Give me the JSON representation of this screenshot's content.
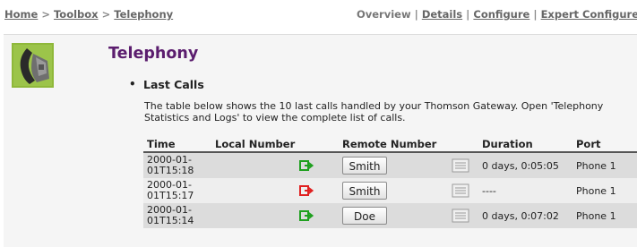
{
  "breadcrumb": {
    "home": "Home",
    "sep1": ">",
    "toolbox": "Toolbox",
    "sep2": ">",
    "telephony": "Telephony"
  },
  "views": {
    "overview": "Overview",
    "sep1": "|",
    "details": "Details",
    "sep2": "|",
    "configure": "Configure",
    "sep3": "|",
    "expert": "Expert Configure"
  },
  "page": {
    "title": "Telephony",
    "section": "Last Calls",
    "description": "The table below shows the 10 last calls handled by your Thomson Gateway. Open 'Telephony Statistics and Logs' to view the complete list of calls."
  },
  "table": {
    "headers": {
      "time": "Time",
      "local": "Local Number",
      "remote": "Remote Number",
      "duration": "Duration",
      "port": "Port"
    },
    "rows": [
      {
        "time_line1": "2000-01-",
        "time_line2": "01T15:18",
        "direction": "green-arrow-icon",
        "arrow_color": "#1fa01f",
        "contact": "Smith",
        "duration": "0 days, 0:05:05",
        "port": "Phone 1"
      },
      {
        "time_line1": "2000-01-",
        "time_line2": "01T15:17",
        "direction": "red-arrow-icon",
        "arrow_color": "#e02020",
        "contact": "Smith",
        "duration": "----",
        "port": "Phone 1"
      },
      {
        "time_line1": "2000-01-",
        "time_line2": "01T15:14",
        "direction": "green-arrow-icon",
        "arrow_color": "#1fa01f",
        "contact": "Doe",
        "duration": "0 days, 0:07:02",
        "port": "Phone 1"
      }
    ]
  },
  "colors": {
    "title": "#5b1d6e",
    "incoming": "#1fa01f",
    "missed": "#e02020"
  }
}
